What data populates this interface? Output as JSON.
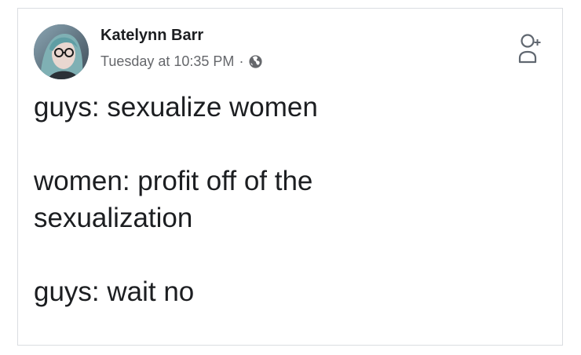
{
  "post": {
    "author": "Katelynn Barr",
    "timestamp": "Tuesday at 10:35 PM",
    "separator": "·",
    "privacy_icon": "globe-icon",
    "action_icon": "add-friend-icon",
    "lines": [
      "guys: sexualize women",
      "women: profit off of the sexualization",
      "guys: wait no"
    ]
  },
  "colors": {
    "text": "#1c1e21",
    "meta": "#65676b",
    "border": "#dadde1"
  }
}
